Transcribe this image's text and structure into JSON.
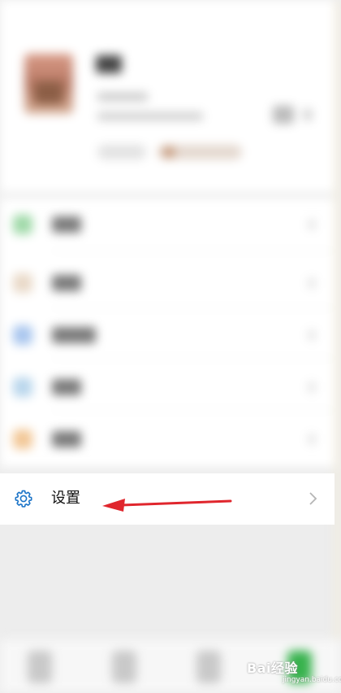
{
  "settings": {
    "label": "设置"
  },
  "icons": {
    "settings_icon": "gear-icon",
    "chevron": "chevron-right-icon",
    "annotation": "red-arrow"
  },
  "colors": {
    "accent": "#1a73c7",
    "annotation_red": "#e0262d",
    "background": "#ededed"
  },
  "watermark": {
    "text": "Bai经验",
    "sub": "jingyan.baidu.com"
  }
}
